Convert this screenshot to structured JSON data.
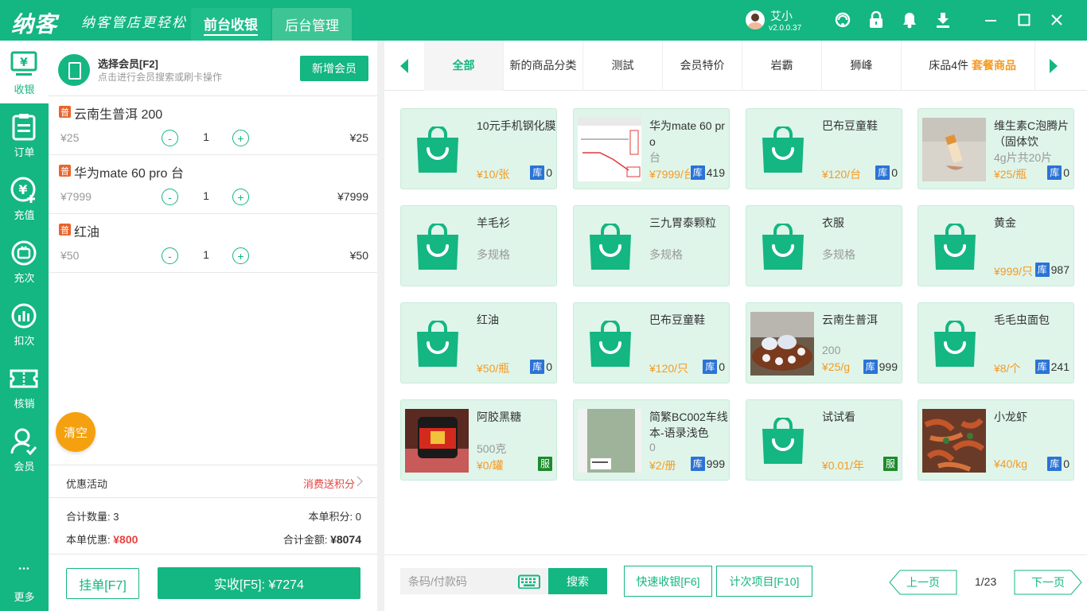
{
  "app": {
    "logo": "纳客",
    "slogan": "纳客管店更轻松",
    "tabs": [
      {
        "label": "前台收银"
      },
      {
        "label": "后台管理"
      }
    ],
    "user": {
      "name": "艾小",
      "version": "v2.0.0.37"
    }
  },
  "nav": [
    {
      "label": "收银",
      "icon": "cashier-icon"
    },
    {
      "label": "订单",
      "icon": "order-icon"
    },
    {
      "label": "充值",
      "icon": "recharge-icon"
    },
    {
      "label": "充次",
      "icon": "recharge-times-icon"
    },
    {
      "label": "扣次",
      "icon": "deduct-times-icon"
    },
    {
      "label": "核销",
      "icon": "ticket-icon"
    },
    {
      "label": "会员",
      "icon": "member-icon"
    },
    {
      "label": "更多",
      "icon": "more-icon"
    }
  ],
  "member": {
    "title": "选择会员[F2]",
    "subtitle": "点击进行会员搜索或刷卡操作",
    "new_button": "新增会员"
  },
  "cart": {
    "items": [
      {
        "badge": "普",
        "name": "云南生普洱 200",
        "unit_price": "¥25",
        "minus": "-",
        "qty": "1",
        "plus": "+",
        "total": "¥25"
      },
      {
        "badge": "普",
        "name": "华为mate 60 pro 台",
        "unit_price": "¥7999",
        "minus": "-",
        "qty": "1",
        "plus": "+",
        "total": "¥7999"
      },
      {
        "badge": "普",
        "name": "红油",
        "unit_price": "¥50",
        "minus": "-",
        "qty": "1",
        "plus": "+",
        "total": "¥50"
      }
    ],
    "clear": "清空",
    "promo_label": "优惠活动",
    "promo_link": "消费送积分",
    "count_label": "合计数量:",
    "count_value": "3",
    "points_label": "本单积分:",
    "points_value": "0",
    "discount_label": "本单优惠:",
    "discount_value": "¥800",
    "amount_label": "合计金额:",
    "amount_value": "¥8074",
    "hold_button": "挂单[F7]",
    "pay_button": "实收[F5]: ¥7274"
  },
  "categories": [
    {
      "label": "全部"
    },
    {
      "label": "新的商品分类"
    },
    {
      "label": "测試"
    },
    {
      "label": "会员特价"
    },
    {
      "label": "岩霸"
    },
    {
      "label": "狮峰"
    },
    {
      "label": "床品4件"
    },
    {
      "label": "套餐商品"
    }
  ],
  "products": [
    {
      "name": "10元手机钢化膜",
      "spec": "",
      "price": "¥10/张",
      "stock_tag": "库",
      "stock": "0",
      "image": "bag"
    },
    {
      "name": "华为mate 60 pro",
      "spec": "台",
      "price": "¥7999/台",
      "stock_tag": "库",
      "stock": "419",
      "image": "screenshot"
    },
    {
      "name": "巴布豆童鞋",
      "spec": "",
      "price": "¥120/台",
      "stock_tag": "库",
      "stock": "0",
      "image": "bag"
    },
    {
      "name": "维生素C泡腾片（固体饮",
      "spec": "4g片共20片",
      "price": "¥25/瓶",
      "stock_tag": "库",
      "stock": "0",
      "image": "tablet"
    },
    {
      "name": "羊毛衫",
      "spec": "多规格",
      "price": "",
      "stock_tag": "",
      "stock": "",
      "image": "bag"
    },
    {
      "name": "三九胃泰颗粒",
      "spec": "多规格",
      "price": "",
      "stock_tag": "",
      "stock": "",
      "image": "bag"
    },
    {
      "name": "衣服",
      "spec": "多规格",
      "price": "",
      "stock_tag": "",
      "stock": "",
      "image": "bag"
    },
    {
      "name": "黄金",
      "spec": "",
      "price": "¥999/只",
      "stock_tag": "库",
      "stock": "987",
      "image": "bag"
    },
    {
      "name": "红油",
      "spec": "",
      "price": "¥50/瓶",
      "stock_tag": "库",
      "stock": "0",
      "image": "bag"
    },
    {
      "name": "巴布豆童鞋",
      "spec": "",
      "price": "¥120/只",
      "stock_tag": "库",
      "stock": "0",
      "image": "bag"
    },
    {
      "name": "云南生普洱",
      "spec": "200",
      "price": "¥25/g",
      "stock_tag": "库",
      "stock": "999",
      "image": "teaset"
    },
    {
      "name": "毛毛虫面包",
      "spec": "",
      "price": "¥8/个",
      "stock_tag": "库",
      "stock": "241",
      "image": "bag"
    },
    {
      "name": "阿胶黑糖",
      "spec": "500克",
      "price": "¥0/罐",
      "stock_tag": "服",
      "stock": "",
      "image": "jar"
    },
    {
      "name": "简繁BC002车线本-语录浅色",
      "spec": "0",
      "price": "¥2/册",
      "stock_tag": "库",
      "stock": "999",
      "image": "notebook"
    },
    {
      "name": "试试看",
      "spec": "",
      "price": "¥0.01/年",
      "stock_tag": "服",
      "stock": "",
      "image": "bag"
    },
    {
      "name": "小龙虾",
      "spec": "",
      "price": "¥40/kg",
      "stock_tag": "库",
      "stock": "0",
      "image": "crayfish"
    }
  ],
  "bottom": {
    "scan_placeholder": "条码/付款码",
    "search_button": "搜索",
    "quick_button": "快速收银[F6]",
    "times_button": "计次项目[F10]",
    "prev_button": "上一页",
    "page": "1/23",
    "next_button": "下一页"
  },
  "colors": {
    "primary": "#14b682",
    "price": "#f59a23",
    "danger": "#e64340",
    "stock_badge": "#2b73d6",
    "service_badge": "#1e8a2d"
  }
}
